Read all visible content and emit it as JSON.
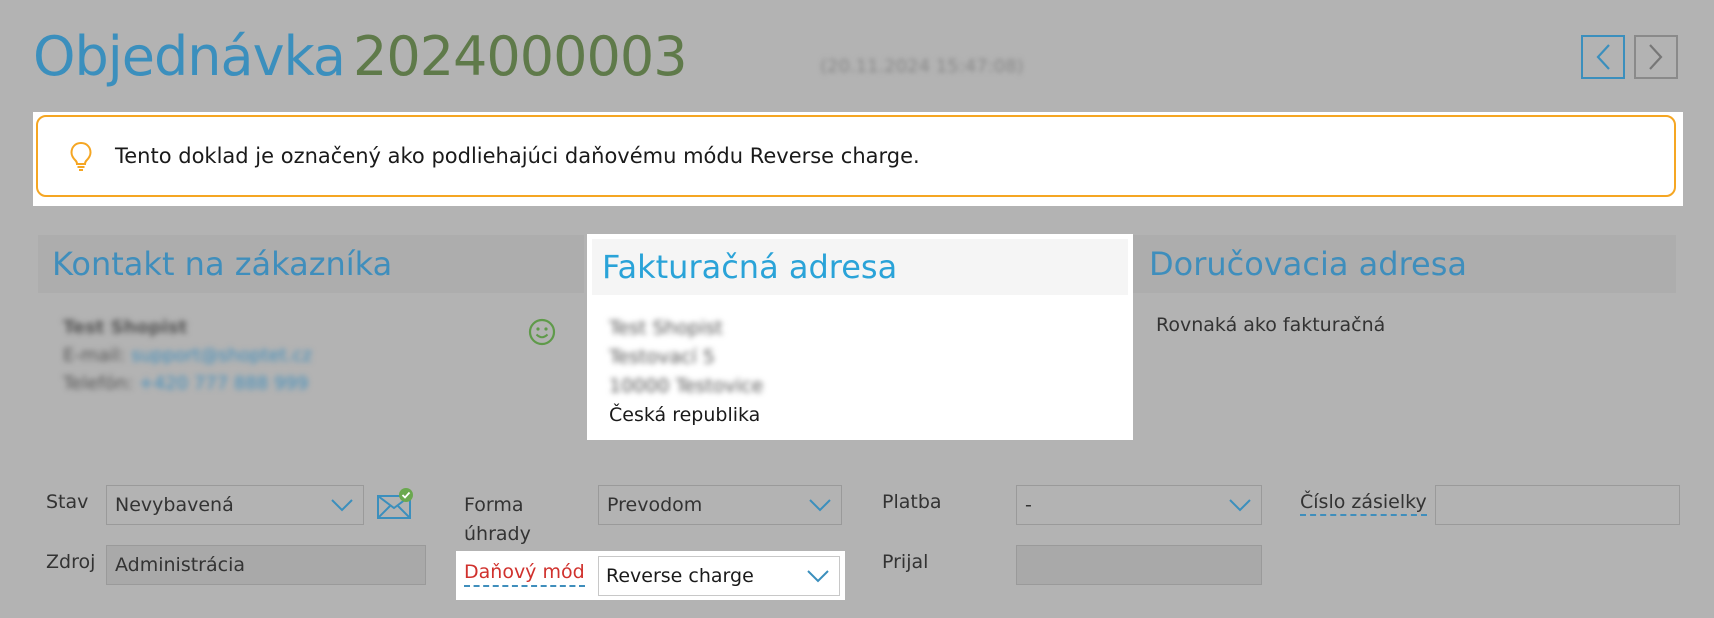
{
  "header": {
    "title_word": "Objednávka",
    "order_number": "2024000003",
    "datetime": "(20.11.2024 15:47:08)"
  },
  "notice": {
    "text": "Tento doklad je označený ako podliehajúci daňovému módu Reverse charge.",
    "icon": "lightbulb-icon"
  },
  "sections": {
    "contact": {
      "title": "Kontakt na zákazníka",
      "name": "Test Shopist",
      "email_label": "E-mail:",
      "email": "support@shoptet.cz",
      "phone_label": "Telefón:",
      "phone": "+420 777 888 999"
    },
    "billing": {
      "title": "Fakturačná adresa",
      "lines": [
        "Test Shopist",
        "Testovací 5",
        "10000 Testovice",
        "Česká republika"
      ]
    },
    "delivery": {
      "title": "Doručovacia adresa",
      "text": "Rovnaká ako fakturačná"
    }
  },
  "form": {
    "status_label": "Stav",
    "status_value": "Nevybavená",
    "source_label": "Zdroj",
    "source_value": "Administrácia",
    "payment_form_label_1": "Forma",
    "payment_form_label_2": "úhrady",
    "payment_form_value": "Prevodom",
    "tax_mode_label": "Daňový mód",
    "tax_mode_value": "Reverse charge",
    "payment_label": "Platba",
    "payment_value": "-",
    "received_label": "Prijal",
    "received_value": "",
    "shipment_label": "Číslo zásielky",
    "shipment_value": ""
  },
  "colors": {
    "accent": "#3b8fbd",
    "order_number": "#5f7a4a",
    "notice_border": "#f5a623",
    "error_red": "#d0312d",
    "overlay_gray": "#b3b3b3"
  }
}
